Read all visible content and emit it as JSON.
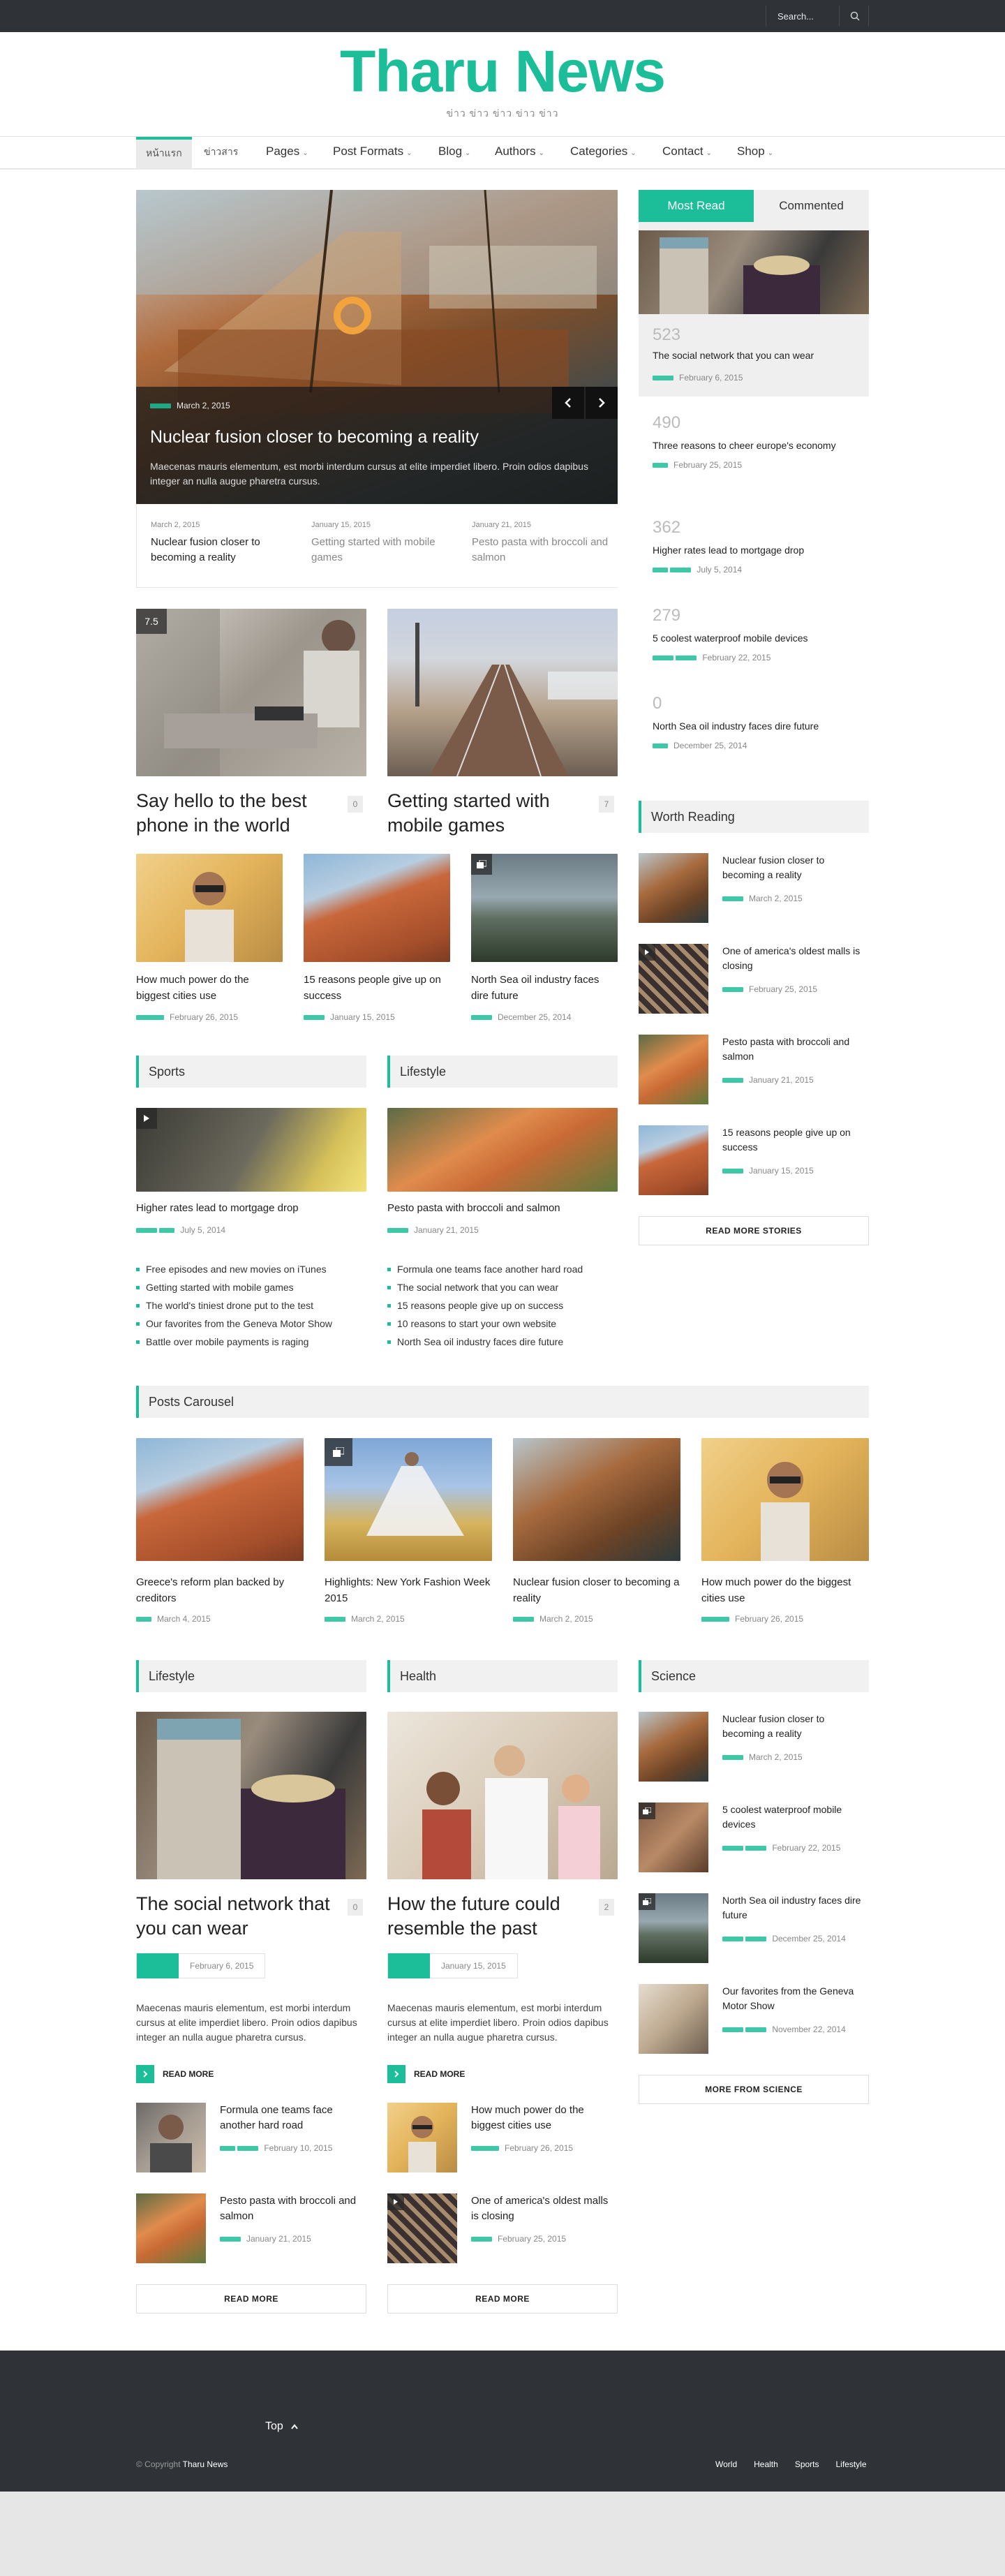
{
  "topbar": {
    "search_placeholder": "Search..."
  },
  "header": {
    "logo": "Tharu News",
    "tagline": "ข่าว ข่าว ข่าว ข่าว ข่าว"
  },
  "nav": {
    "items": [
      {
        "label": "หน้าแรก"
      },
      {
        "label": "ข่าวสาร"
      },
      {
        "label": "Pages"
      },
      {
        "label": "Post Formats"
      },
      {
        "label": "Blog"
      },
      {
        "label": "Authors"
      },
      {
        "label": "Categories"
      },
      {
        "label": "Contact"
      },
      {
        "label": "Shop"
      }
    ]
  },
  "hero": {
    "date": "March 2, 2015",
    "title": "Nuclear fusion closer to becoming a reality",
    "excerpt": "Maecenas mauris elementum, est morbi interdum cursus at elite imperdiet libero. Proin odios dapibus integer an nulla augue pharetra cursus."
  },
  "hero_tabs": [
    {
      "date": "March 2, 2015",
      "title": "Nuclear fusion closer to becoming a reality"
    },
    {
      "date": "January 15, 2015",
      "title": "Getting started with mobile games"
    },
    {
      "date": "January 21, 2015",
      "title": "Pesto pasta with broccoli and salmon"
    }
  ],
  "featured": [
    {
      "badge": "7.5",
      "title": "Say hello to the best phone in the world",
      "count": "0"
    },
    {
      "title": "Getting started with mobile games",
      "count": "7"
    }
  ],
  "small_posts": [
    {
      "title": "How much power do the biggest cities use",
      "date": "February 26, 2015"
    },
    {
      "title": "15 reasons people give up on success",
      "date": "January 15, 2015"
    },
    {
      "title": "North Sea oil industry faces dire future",
      "date": "December 25, 2014"
    }
  ],
  "sports": {
    "heading": "Sports",
    "title": "Higher rates lead to mortgage drop",
    "date": "July 5, 2014",
    "list": [
      "Free episodes and new movies on iTunes",
      "Getting started with mobile games",
      "The world's tiniest drone put to the test",
      "Our favorites from the Geneva Motor Show",
      "Battle over mobile payments is raging"
    ]
  },
  "lifestyle_top": {
    "heading": "Lifestyle",
    "title": "Pesto pasta with broccoli and salmon",
    "date": "January 21, 2015",
    "list": [
      "Formula one teams face another hard road",
      "The social network that you can wear",
      "15 reasons people give up on success",
      "10 reasons to start your own website",
      "North Sea oil industry faces dire future"
    ]
  },
  "sidebar_tabs": {
    "tab1": "Most Read",
    "tab2": "Commented"
  },
  "most_read": [
    {
      "count": "523",
      "title": "The social network that you can wear",
      "date": "February 6, 2015"
    },
    {
      "count": "490",
      "title": "Three reasons to cheer europe's economy",
      "date": "February 25, 2015"
    },
    {
      "count": "362",
      "title": "Higher rates lead to mortgage drop",
      "date": "July 5, 2014"
    },
    {
      "count": "279",
      "title": "5 coolest waterproof mobile devices",
      "date": "February 22, 2015"
    },
    {
      "count": "0",
      "title": "North Sea oil industry faces dire future",
      "date": "December 25, 2014"
    }
  ],
  "worth_reading": {
    "heading": "Worth Reading",
    "items": [
      {
        "title": "Nuclear fusion closer to becoming a reality",
        "date": "March 2, 2015"
      },
      {
        "title": "One of america's oldest malls is closing",
        "date": "February 25, 2015"
      },
      {
        "title": "Pesto pasta with broccoli and salmon",
        "date": "January 21, 2015"
      },
      {
        "title": "15 reasons people give up on success",
        "date": "January 15, 2015"
      }
    ],
    "button": "READ MORE STORIES"
  },
  "carousel": {
    "heading": "Posts Carousel",
    "items": [
      {
        "title": "Greece's reform plan backed by creditors",
        "date": "March 4, 2015"
      },
      {
        "title": "Highlights: New York Fashion Week 2015",
        "date": "March 2, 2015"
      },
      {
        "title": "Nuclear fusion closer to becoming a reality",
        "date": "March 2, 2015"
      },
      {
        "title": "How much power do the biggest cities use",
        "date": "February 26, 2015"
      }
    ]
  },
  "lifestyle": {
    "heading": "Lifestyle",
    "title": "The social network that you can wear",
    "count": "0",
    "date": "February 6, 2015",
    "excerpt": "Maecenas mauris elementum, est morbi interdum cursus at elite imperdiet libero. Proin odios dapibus integer an nulla augue pharetra cursus.",
    "readmore": "READ MORE",
    "list": [
      {
        "title": "Formula one teams face another hard road",
        "date": "February 10, 2015"
      },
      {
        "title": "Pesto pasta with broccoli and salmon",
        "date": "January 21, 2015"
      }
    ],
    "button": "READ MORE"
  },
  "health": {
    "heading": "Health",
    "title": "How the future could resemble the past",
    "count": "2",
    "date": "January 15, 2015",
    "excerpt": "Maecenas mauris elementum, est morbi interdum cursus at elite imperdiet libero. Proin odios dapibus integer an nulla augue pharetra cursus.",
    "readmore": "READ MORE",
    "list": [
      {
        "title": "How much power do the biggest cities use",
        "date": "February 26, 2015"
      },
      {
        "title": "One of america's oldest malls is closing",
        "date": "February 25, 2015"
      }
    ],
    "button": "READ MORE"
  },
  "science": {
    "heading": "Science",
    "items": [
      {
        "title": "Nuclear fusion closer to becoming a reality",
        "date": "March 2, 2015"
      },
      {
        "title": "5 coolest waterproof mobile devices",
        "date": "February 22, 2015"
      },
      {
        "title": "North Sea oil industry faces dire future",
        "date": "December 25, 2014"
      },
      {
        "title": "Our favorites from the Geneva Motor Show",
        "date": "November 22, 2014"
      }
    ],
    "button": "MORE FROM SCIENCE"
  },
  "footer": {
    "top": "Top",
    "copyright_prefix": "© Copyright",
    "copyright_brand": "Tharu News",
    "links": [
      "World",
      "Health",
      "Sports",
      "Lifestyle"
    ]
  },
  "colors": {
    "accent": "#1cbe99",
    "dark": "#2f3338"
  }
}
